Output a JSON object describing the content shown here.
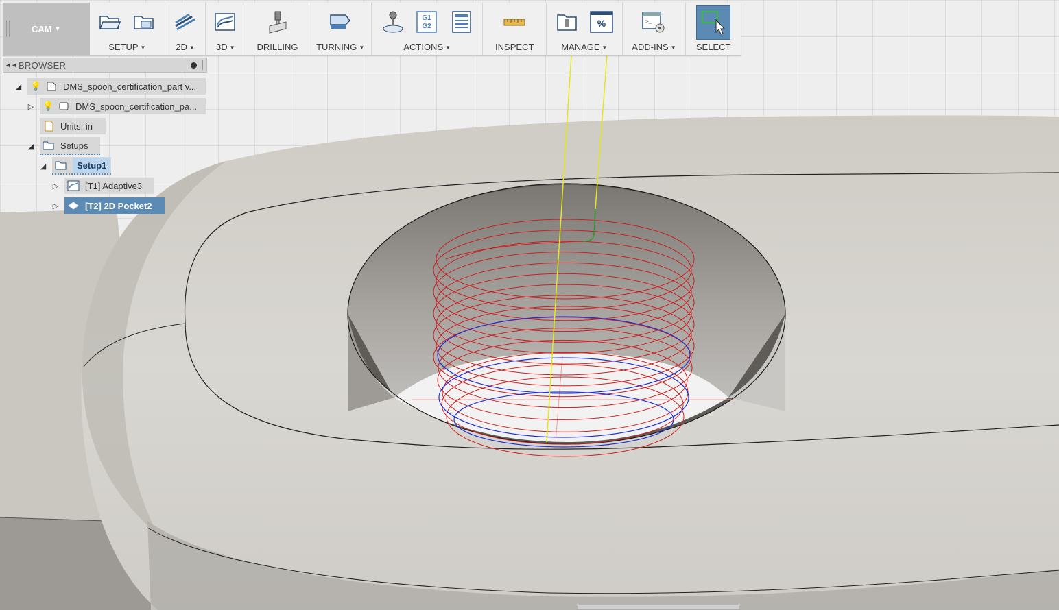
{
  "workspace": {
    "label": "CAM"
  },
  "toolbar": {
    "groups": [
      {
        "label": "SETUP",
        "dropdown": true
      },
      {
        "label": "2D",
        "dropdown": true
      },
      {
        "label": "3D",
        "dropdown": true
      },
      {
        "label": "DRILLING",
        "dropdown": false
      },
      {
        "label": "TURNING",
        "dropdown": true
      },
      {
        "label": "ACTIONS",
        "dropdown": true
      },
      {
        "label": "INSPECT",
        "dropdown": false
      },
      {
        "label": "MANAGE",
        "dropdown": true
      },
      {
        "label": "ADD-INS",
        "dropdown": true
      },
      {
        "label": "SELECT",
        "dropdown": false
      }
    ],
    "actions_gcode_icon_text": [
      "G1",
      "G2"
    ],
    "manage_icon_text": "%"
  },
  "browser": {
    "title": "BROWSER",
    "tree": {
      "root": "DMS_spoon_certification_part v...",
      "component": "DMS_spoon_certification_pa...",
      "units": "Units: in",
      "setups": "Setups",
      "setup1": "Setup1",
      "op1": "[T1] Adaptive3",
      "op2": "[T2] 2D Pocket2"
    }
  },
  "colors": {
    "accent": "#5b8bb5",
    "toolpath_feed": "#cc1f1f",
    "toolpath_lead": "#1f2fd6",
    "toolpath_rapid": "#e6e619",
    "toolpath_plunge": "#2f9c2f",
    "model_face": "#d6d4cf"
  }
}
